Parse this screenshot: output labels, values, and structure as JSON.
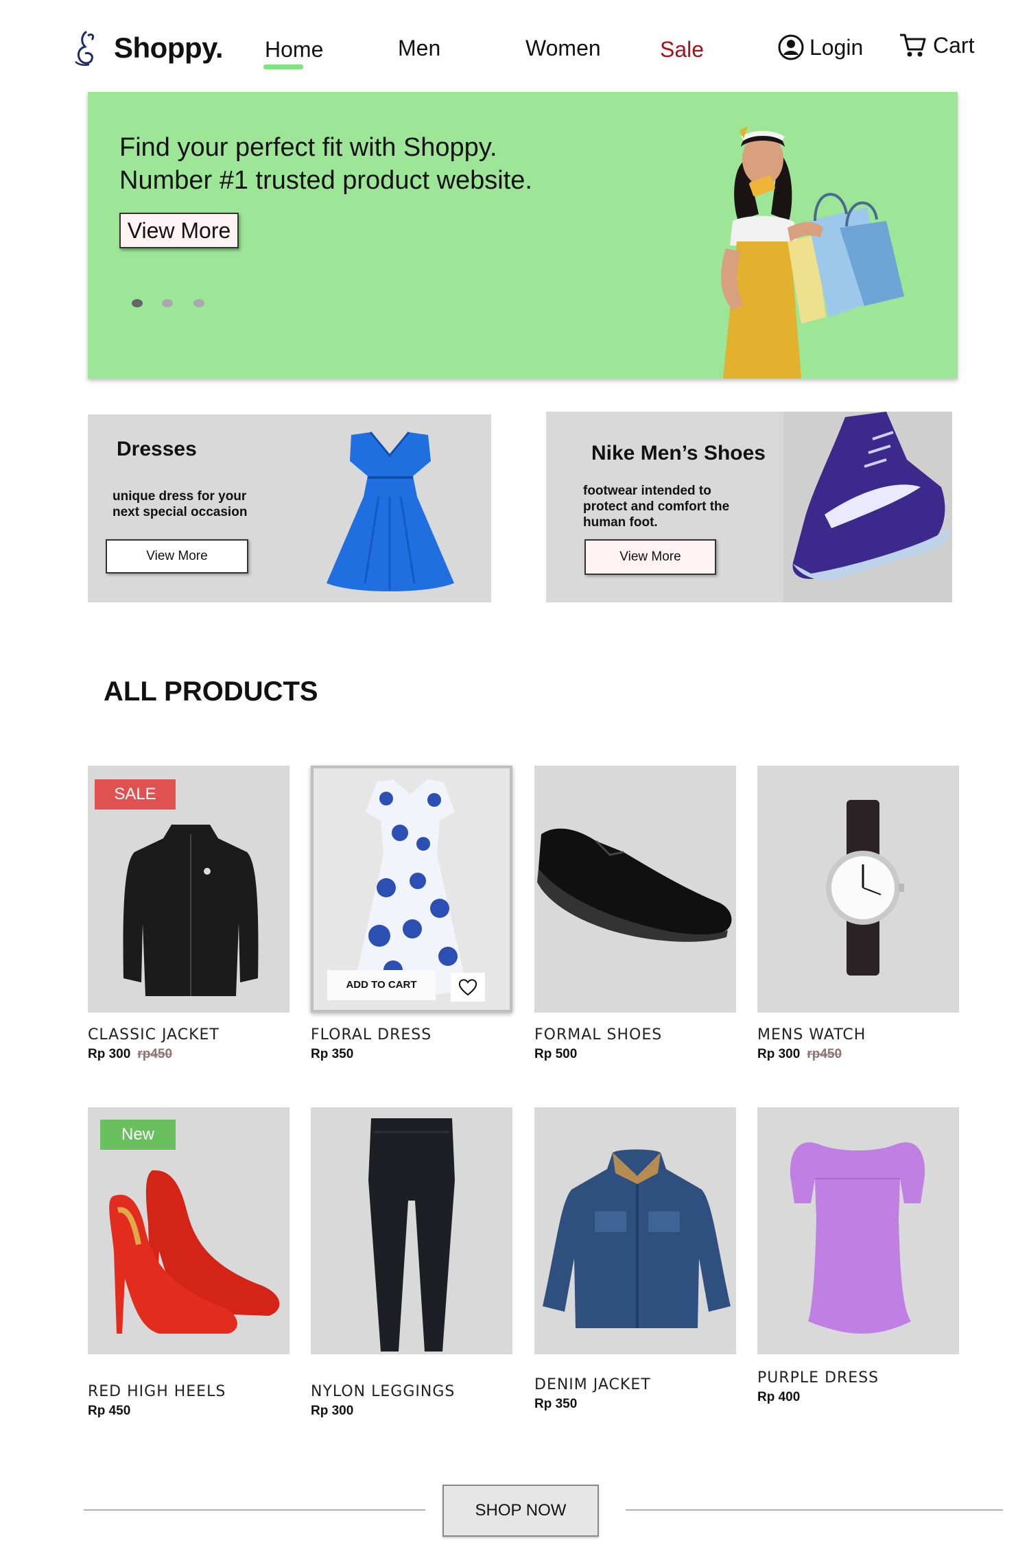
{
  "brand": {
    "name": "Shoppy."
  },
  "nav": {
    "home": "Home",
    "men": "Men",
    "women": "Women",
    "sale": "Sale",
    "login": "Login",
    "cart": "Cart"
  },
  "colors": {
    "accent_green": "#9de597",
    "sale_red": "#a8111a",
    "badge_sale": "#e05252",
    "badge_new": "#6abf5e",
    "card_bg": "#d9d9d9"
  },
  "hero": {
    "line1": "Find your perfect fit with Shoppy.",
    "line2": "Number #1 trusted product website.",
    "button": "View More",
    "carousel_active_index": 0,
    "carousel_count": 3
  },
  "promos": [
    {
      "title": "Dresses",
      "desc": "unique dress for your next special occasion",
      "button": "View More"
    },
    {
      "title": "Nike Men’s Shoes",
      "desc": "footwear intended to protect and comfort the human foot.",
      "button": "View More"
    }
  ],
  "products_section": {
    "title": "ALL PRODUCTS"
  },
  "products": [
    {
      "name": "CLASSIC JACKET",
      "price": "Rp 300",
      "old_price": "rp450",
      "badge": "SALE",
      "icon": "jacket-icon"
    },
    {
      "name": "FLORAL DRESS",
      "price": "Rp 350",
      "old_price": "",
      "badge": "",
      "icon": "dress-icon",
      "add_to_cart": "ADD TO CART"
    },
    {
      "name": "FORMAL SHOES",
      "price": "Rp 500",
      "old_price": "",
      "badge": "",
      "icon": "shoe-icon"
    },
    {
      "name": "MENS WATCH",
      "price": "Rp 300",
      "old_price": "rp450",
      "badge": "",
      "icon": "watch-icon"
    },
    {
      "name": "RED HIGH HEELS",
      "price": "Rp 450",
      "old_price": "",
      "badge": "New",
      "icon": "heels-icon"
    },
    {
      "name": "NYLON LEGGINGS",
      "price": "Rp 300",
      "old_price": "",
      "badge": "",
      "icon": "leggings-icon"
    },
    {
      "name": "DENIM JACKET",
      "price": "Rp 350",
      "old_price": "",
      "badge": "",
      "icon": "jacket-icon"
    },
    {
      "name": "PURPLE DRESS",
      "price": "Rp 400",
      "old_price": "",
      "badge": "",
      "icon": "dress-icon"
    }
  ],
  "footer": {
    "shop_now": "SHOP NOW"
  }
}
